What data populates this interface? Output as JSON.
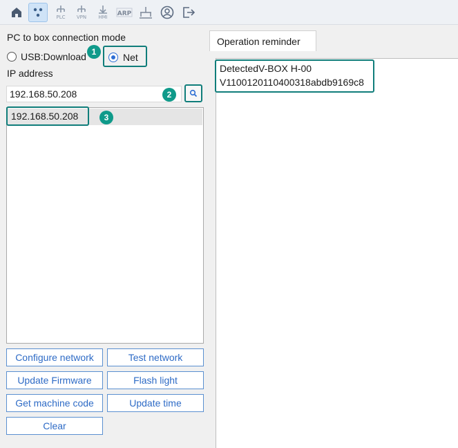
{
  "toolbar": {
    "items": [
      {
        "icon": "home-icon",
        "label": ""
      },
      {
        "icon": "network-nodes-icon",
        "label": "",
        "active": true
      },
      {
        "icon": "plc-icon",
        "label": "PLC"
      },
      {
        "icon": "vpn-icon",
        "label": "VPN"
      },
      {
        "icon": "hmi-icon",
        "label": "HMI"
      },
      {
        "icon": "arp-icon",
        "label": "ARP"
      },
      {
        "icon": "ethernet-icon",
        "label": ""
      },
      {
        "icon": "user-icon",
        "label": ""
      },
      {
        "icon": "logout-icon",
        "label": ""
      }
    ]
  },
  "connection": {
    "mode_label": "PC to box connection mode",
    "usb_label": "USB:Download",
    "net_label": "Net",
    "selected": "Net"
  },
  "ip": {
    "label": "IP address",
    "value": "192.168.50.208",
    "search_icon": "search-icon"
  },
  "ip_list": [
    "192.168.50.208"
  ],
  "buttons": {
    "configure_network": "Configure network",
    "test_network": "Test network",
    "update_firmware": "Update Firmware",
    "flash_light": "Flash light",
    "get_machine_code": "Get machine code",
    "update_time": "Update time",
    "clear": "Clear"
  },
  "annotations": {
    "badge1": "1",
    "badge2": "2",
    "badge3": "3",
    "highlight_color": "#0f7d7a",
    "badge_color": "#0f9a8a"
  },
  "reminder": {
    "tab_label": "Operation reminder",
    "lines": [
      "DetectedV-BOX H-00",
      "V1100120110400318abdb9169c8"
    ]
  }
}
